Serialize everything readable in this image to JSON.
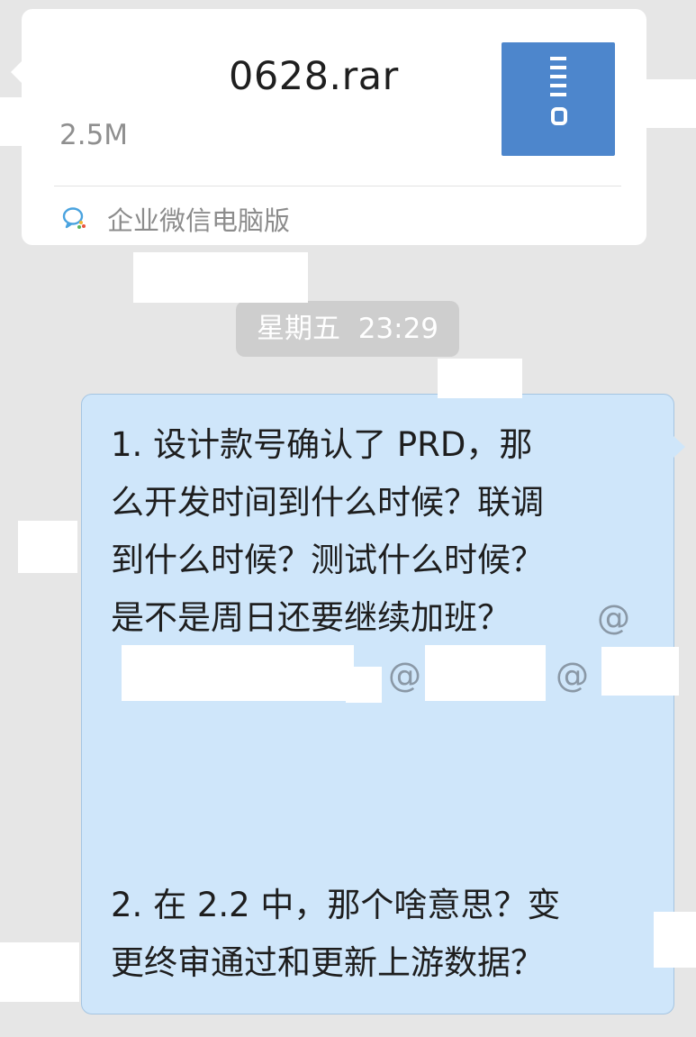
{
  "file_message": {
    "file_name_visible": "0628.rar",
    "file_size": "2.5M",
    "file_type_icon": "zip-archive-icon",
    "source_label": "企业微信电脑版",
    "source_icon": "wecom-logo-icon",
    "icon_color": "#4d86cc"
  },
  "timestamp": {
    "day": "星期五",
    "time": "23:29"
  },
  "text_message": {
    "bubble_color": "#cfe6fa",
    "lines": [
      "1. 设计款号确认了 PRD，那",
      "么开发时间到什么时候？联调",
      "到什么时候？测试什么时候？",
      "是不是周日还要继续加班？",
      "2. 在 2.2 中，那个啥意思？变",
      "更终审通过和更新上游数据？"
    ],
    "mention_symbol": "@"
  }
}
